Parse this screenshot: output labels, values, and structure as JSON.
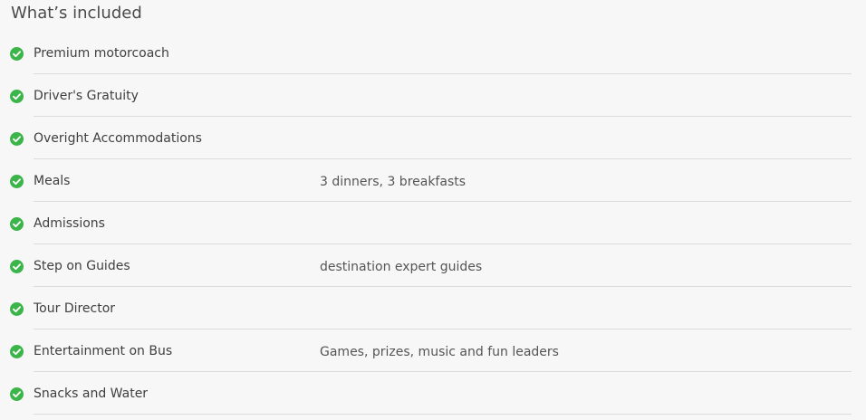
{
  "section": {
    "title": "What’s included"
  },
  "items": [
    {
      "label": "Premium motorcoach",
      "detail": "",
      "icon": "check-circle-icon"
    },
    {
      "label": "Driver's Gratuity",
      "detail": "",
      "icon": "check-circle-icon"
    },
    {
      "label": "Overight Accommodations",
      "detail": "",
      "icon": "check-circle-icon"
    },
    {
      "label": "Meals",
      "detail": "3 dinners, 3 breakfasts",
      "icon": "check-circle-icon"
    },
    {
      "label": "Admissions",
      "detail": "",
      "icon": "check-circle-icon"
    },
    {
      "label": "Step on Guides",
      "detail": "destination expert guides",
      "icon": "check-circle-icon"
    },
    {
      "label": "Tour Director",
      "detail": "",
      "icon": "check-circle-icon"
    },
    {
      "label": "Entertainment on Bus",
      "detail": "Games, prizes, music and fun leaders",
      "icon": "check-circle-icon"
    },
    {
      "label": "Snacks and Water",
      "detail": "",
      "icon": "check-circle-icon"
    }
  ],
  "colors": {
    "check": "#3bb54a",
    "divider": "#dcdcdc",
    "background": "#f7f7f7"
  }
}
